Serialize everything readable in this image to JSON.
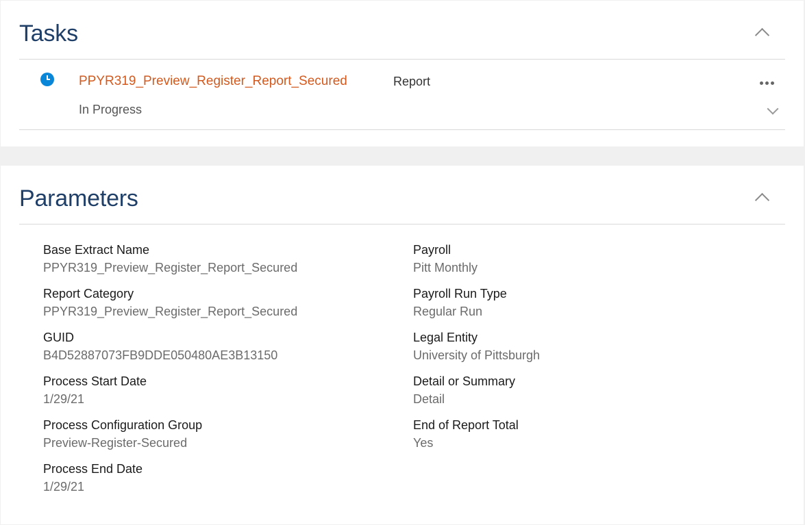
{
  "tasks": {
    "title": "Tasks",
    "items": [
      {
        "name": "PPYR319_Preview_Register_Report_Secured",
        "type": "Report",
        "status": "In Progress"
      }
    ]
  },
  "parameters": {
    "title": "Parameters",
    "left": [
      {
        "label": "Base Extract Name",
        "value": "PPYR319_Preview_Register_Report_Secured"
      },
      {
        "label": "Report Category",
        "value": "PPYR319_Preview_Register_Report_Secured"
      },
      {
        "label": "GUID",
        "value": "B4D52887073FB9DDE050480AE3B13150"
      },
      {
        "label": "Process Start Date",
        "value": "1/29/21"
      },
      {
        "label": "Process Configuration Group",
        "value": "Preview-Register-Secured"
      },
      {
        "label": "Process End Date",
        "value": "1/29/21"
      }
    ],
    "right": [
      {
        "label": "Payroll",
        "value": "Pitt Monthly"
      },
      {
        "label": "Payroll Run Type",
        "value": "Regular Run"
      },
      {
        "label": "Legal Entity",
        "value": "University of Pittsburgh"
      },
      {
        "label": "Detail or Summary",
        "value": "Detail"
      },
      {
        "label": "End of Report Total",
        "value": "Yes"
      }
    ]
  },
  "colors": {
    "section_title": "#1f3f68",
    "task_link": "#d35a1f",
    "status_icon": "#0a86d9",
    "page_bg": "#f0f0f0"
  },
  "icons": {
    "task_status": "clock-icon",
    "collapse": "chevron-up-icon",
    "expand": "chevron-down-icon",
    "actions": "more-horizontal-icon"
  }
}
